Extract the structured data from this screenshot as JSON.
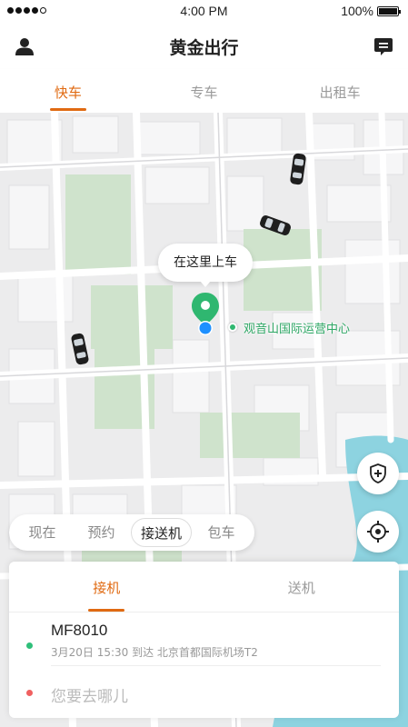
{
  "status_bar": {
    "time": "4:00 PM",
    "battery": "100%"
  },
  "header": {
    "title": "黄金出行"
  },
  "tabs": [
    {
      "label": "快车",
      "active": true
    },
    {
      "label": "专车",
      "active": false
    },
    {
      "label": "出租车",
      "active": false
    }
  ],
  "map": {
    "pickup_bubble": "在这里上车",
    "poi_label": "观音山国际运营中心"
  },
  "service_types": [
    {
      "label": "现在",
      "active": false
    },
    {
      "label": "预约",
      "active": false
    },
    {
      "label": "接送机",
      "active": true
    },
    {
      "label": "包车",
      "active": false
    }
  ],
  "card": {
    "tabs": [
      {
        "label": "接机",
        "active": true
      },
      {
        "label": "送机",
        "active": false
      }
    ],
    "flight_number": "MF8010",
    "flight_info": "3月20日 15:30 到达 北京首都国际机场T2",
    "destination_placeholder": "您要去哪儿"
  },
  "colors": {
    "accent": "#e06a12",
    "pin_green": "#2fb770",
    "location_blue": "#1e90ff",
    "start_dot": "#2fbf7a",
    "end_dot": "#f06060",
    "water": "#8dd3e0",
    "park": "#cfe3cc"
  }
}
